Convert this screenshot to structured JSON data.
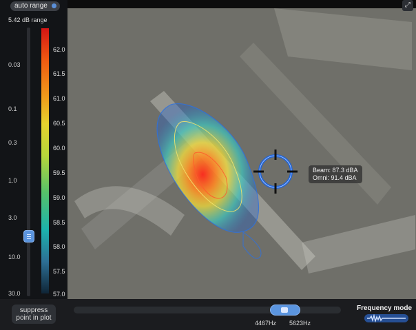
{
  "controls": {
    "auto_range_label": "auto range",
    "range_display": "5.42 dB range",
    "suppress_label_line1": "suppress",
    "suppress_label_line2": "point in plot",
    "frequency_mode_label": "Frequency mode",
    "expand_icon": "fullscreen-icon"
  },
  "left_scale": {
    "ticks": [
      "0.03",
      "0.1",
      "0.3",
      "1.0",
      "3.0",
      "10.0",
      "30.0"
    ],
    "slider_value": 3.0
  },
  "colorbar": {
    "labels": [
      "62.0",
      "61.5",
      "61.0",
      "60.5",
      "60.0",
      "59.5",
      "59.0",
      "58.5",
      "58.0",
      "57.5",
      "57.0"
    ],
    "colors": [
      "#d51515",
      "#ef5a11",
      "#f09c1b",
      "#e6d12e",
      "#b7d63b",
      "#56c16a",
      "#1cb3ad",
      "#2d6f95",
      "#0f2536"
    ]
  },
  "tooltip": {
    "line1": "Beam: 87.3 dBA",
    "line2": "Omni: 91.4 dBA"
  },
  "frequency": {
    "low": "4467Hz",
    "high": "5623Hz"
  }
}
